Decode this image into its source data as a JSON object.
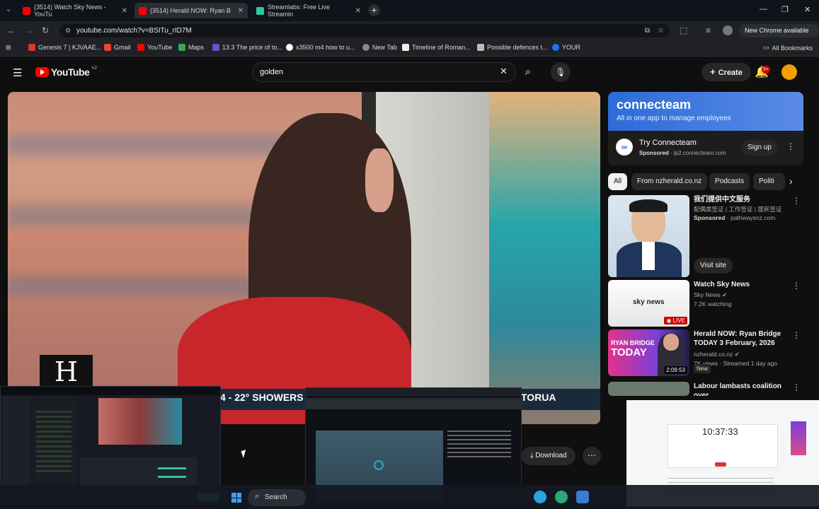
{
  "tabs": [
    {
      "title": "(3514) Watch Sky News - YouTu",
      "icon": "youtube-icon",
      "active": false
    },
    {
      "title": "(3514) Herald NOW: Ryan B",
      "icon": "youtube-icon",
      "active": true
    },
    {
      "title": "Streamlabs: Free Live Streamin",
      "icon": "streamlabs-icon",
      "active": false
    }
  ],
  "address_bar": {
    "url": "youtube.com/watch?v=BSITu_rID7M",
    "update_label": "New Chrome available"
  },
  "bookmarks": [
    {
      "label": "Genesis 7 | KJVAAE...",
      "color": "#d33"
    },
    {
      "label": "Gmail",
      "color": "#ea4335"
    },
    {
      "label": "YouTube",
      "color": "#ff0000"
    },
    {
      "label": "Maps",
      "color": "#34a853"
    },
    {
      "label": "13.3 The price of to...",
      "color": "#6a4fc7"
    },
    {
      "label": "x3500 m4 how to u...",
      "color": "#ffffff"
    },
    {
      "label": "New Tab",
      "color": "#888888"
    },
    {
      "label": "Timeline of Roman...",
      "color": "#eeeeee"
    },
    {
      "label": "Possible defences t...",
      "color": "#bbbbbb"
    },
    {
      "label": "YOUR",
      "color": "#1877f2"
    }
  ],
  "all_bookmarks_label": "All Bookmarks",
  "youtube": {
    "logo_text": "YouTube",
    "region": "NZ",
    "search_query": "golden",
    "create_label": "Create",
    "notification_count": "9+"
  },
  "video": {
    "ticker_left": "4 - 22° SHOWERS",
    "ticker_right": "TORUA",
    "logo_letter": "H",
    "download_label": "Download"
  },
  "ad": {
    "brand": "connecteam",
    "tagline": "All in one app to manage employees",
    "title": "Try Connecteam",
    "sponsored": "Sponsored",
    "domain": "lp2.connecteam.com",
    "cta": "Sign up"
  },
  "chips": [
    "All",
    "From nzherald.co.nz",
    "Podcasts",
    "Politi"
  ],
  "recommendations": [
    {
      "title": "我们提供中文服务",
      "subtitle": "配偶类签证 | 工作签证 | 居民签证",
      "meta1": "Sponsored",
      "meta2": "pathwaysnz.com",
      "cta": "Visit site"
    },
    {
      "title": "Watch Sky News",
      "meta1": "Sky News",
      "meta2": "7.2K watching",
      "thumb_text": "sky news",
      "badge": "LIVE"
    },
    {
      "title": "Herald NOW: Ryan Bridge TODAY 3 February, 2026",
      "meta1": "nzherald.co.nz",
      "meta2": "7K views · Streamed 1 day ago",
      "badge_new": "New",
      "duration": "2:09:53",
      "thumb_text1": "RYAN BRIDGE",
      "thumb_text2": "TODAY"
    },
    {
      "title": "Labour lambasts coalition over"
    }
  ],
  "overlay": {
    "clock_time": "10:37:33",
    "taskbar_search": "Search"
  }
}
